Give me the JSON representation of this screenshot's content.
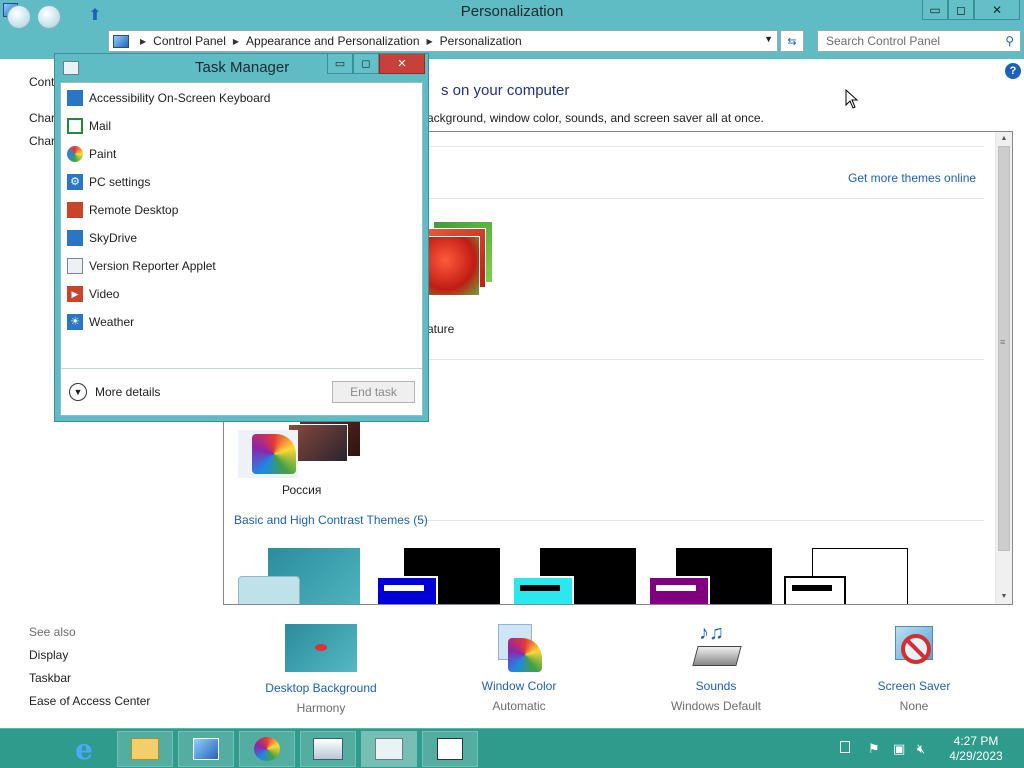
{
  "window": {
    "title": "Personalization",
    "minimize_glyph": "▭",
    "maximize_glyph": "◻",
    "close_glyph": "✕"
  },
  "address": {
    "crumbs": [
      "Control Panel",
      "Appearance and Personalization",
      "Personalization"
    ],
    "search_placeholder": "Search Control Panel"
  },
  "sidepane": {
    "items": [
      "Contr",
      "Char",
      "Char"
    ],
    "see_also": "See also",
    "see_also_links": [
      "Display",
      "Taskbar",
      "Ease of Access Center"
    ]
  },
  "content": {
    "heading": "s on your computer",
    "subheading": "ackground, window color, sounds, and screen saver all at once.",
    "get_more": "Get more themes online",
    "nature_label": "ature",
    "russia_label": "Россия",
    "basic_label": "Basic and High Contrast Themes (5)"
  },
  "bottom": [
    {
      "label": "Desktop Background",
      "sub": "Harmony",
      "icon": "desktop-background-icon"
    },
    {
      "label": "Window Color",
      "sub": "Automatic",
      "icon": "window-color-icon"
    },
    {
      "label": "Sounds",
      "sub": "Windows Default",
      "icon": "sounds-icon"
    },
    {
      "label": "Screen Saver",
      "sub": "None",
      "icon": "screen-saver-icon"
    }
  ],
  "task_manager": {
    "title": "Task Manager",
    "apps": [
      {
        "name": "Accessibility On-Screen Keyboard",
        "icon": "keyboard-icon",
        "color": "#2b76c4"
      },
      {
        "name": "Mail",
        "icon": "mail-icon",
        "color": "#1e8a3a"
      },
      {
        "name": "Paint",
        "icon": "paint-icon",
        "color": "#c98f2a"
      },
      {
        "name": "PC settings",
        "icon": "settings-icon",
        "color": "#2b76c4"
      },
      {
        "name": "Remote Desktop",
        "icon": "remote-desktop-icon",
        "color": "#c9452a"
      },
      {
        "name": "SkyDrive",
        "icon": "skydrive-icon",
        "color": "#2b76c4"
      },
      {
        "name": "Version Reporter Applet",
        "icon": "applet-icon",
        "color": "#7a8590"
      },
      {
        "name": "Video",
        "icon": "video-icon",
        "color": "#c9452a"
      },
      {
        "name": "Weather",
        "icon": "weather-icon",
        "color": "#2b76c4"
      }
    ],
    "more_details": "More details",
    "end_task": "End task"
  },
  "taskbar": {
    "time": "4:27 PM",
    "date": "4/29/2023"
  }
}
